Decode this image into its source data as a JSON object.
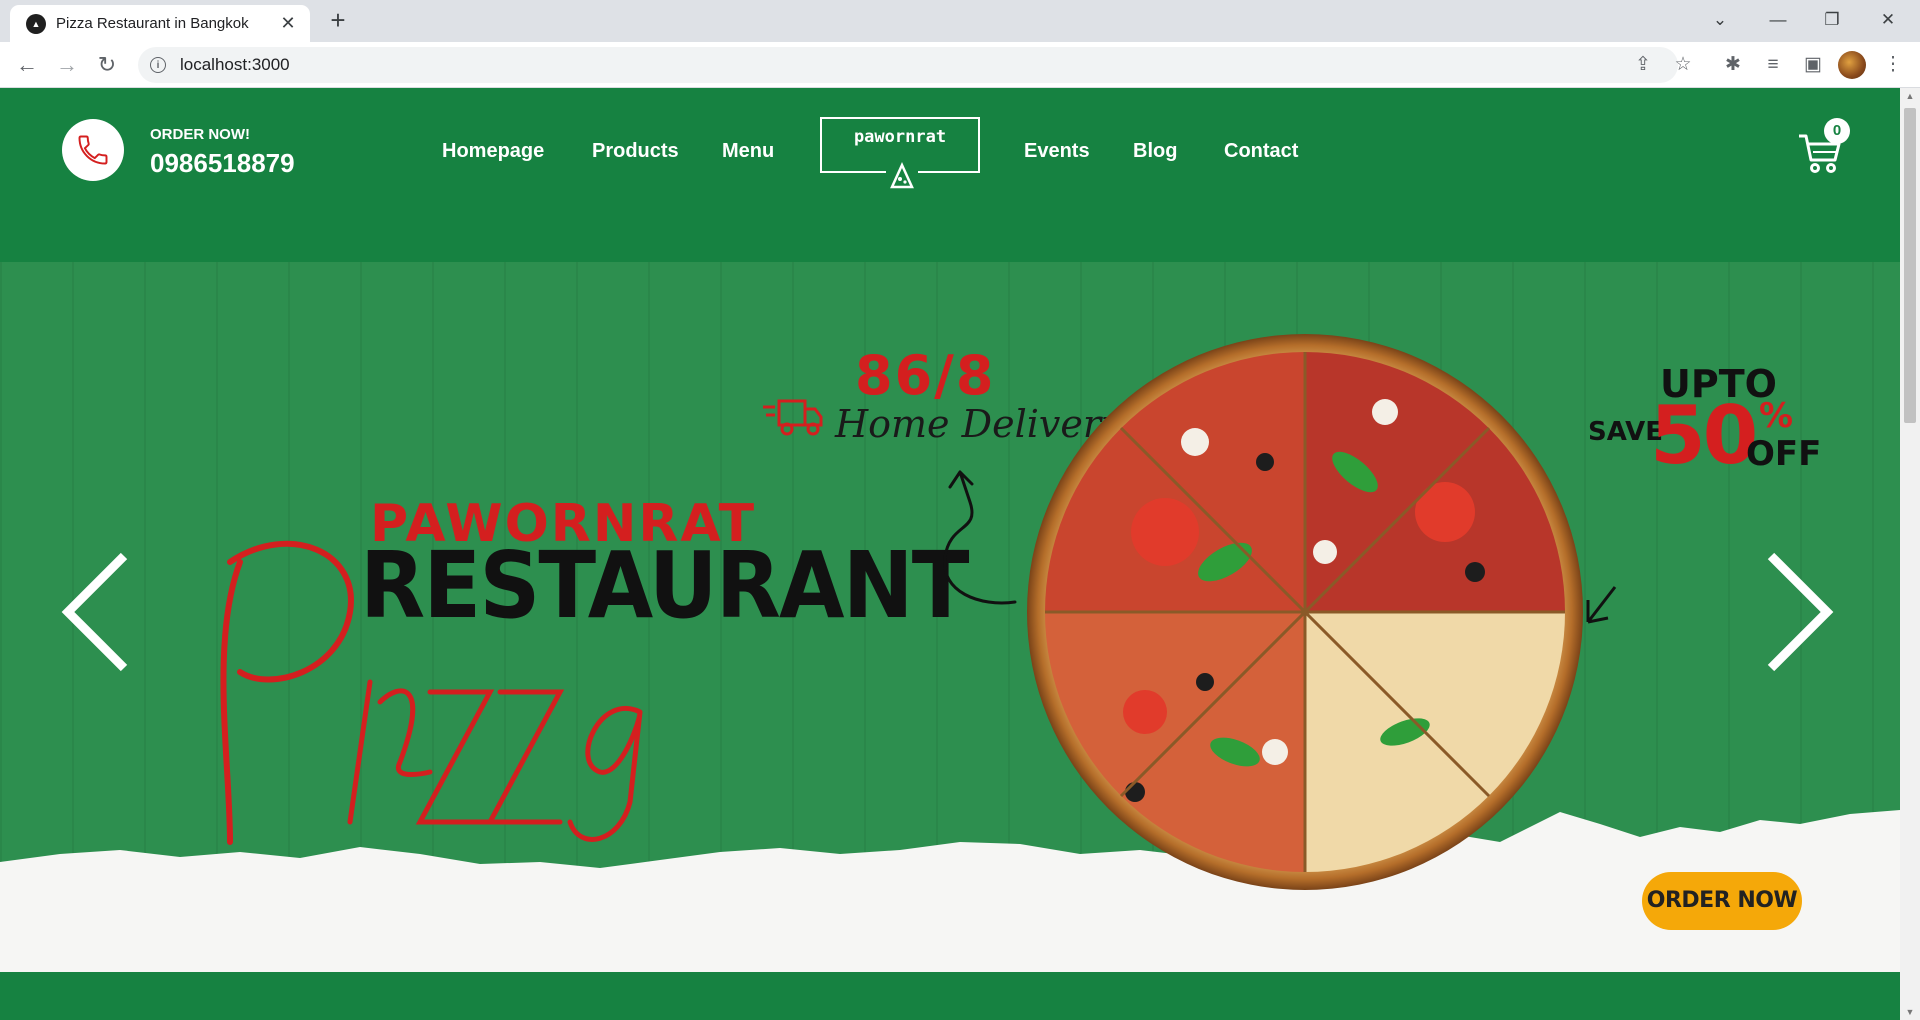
{
  "browser": {
    "tab_title": "Pizza Restaurant in Bangkok",
    "tab_close": "✕",
    "new_tab": "+",
    "url": "localhost:3000",
    "minimize": "—",
    "restore": "❐",
    "close": "✕",
    "tab_search": "⌄"
  },
  "header": {
    "order_label": "ORDER NOW!",
    "phone": "0986518879",
    "nav": [
      "Homepage",
      "Products",
      "Menu",
      "Events",
      "Blog",
      "Contact"
    ],
    "logo_text": "pawornrat",
    "cart_count": "0"
  },
  "hero": {
    "brand_top": "PAWORNRAT",
    "brand_main": "RESTAURANT",
    "brand_script": "Pizza",
    "delivery_number": "86/8",
    "delivery_text": "Home Delivery",
    "promo_upto": "UPTO",
    "promo_save": "SAVE",
    "promo_value": "50",
    "promo_pct": "%",
    "promo_off": "OFF",
    "order_button": "ORDER NOW"
  },
  "colors": {
    "brand_green": "#168241",
    "accent_red": "#d41f1f",
    "button_yellow": "#f5a809"
  }
}
